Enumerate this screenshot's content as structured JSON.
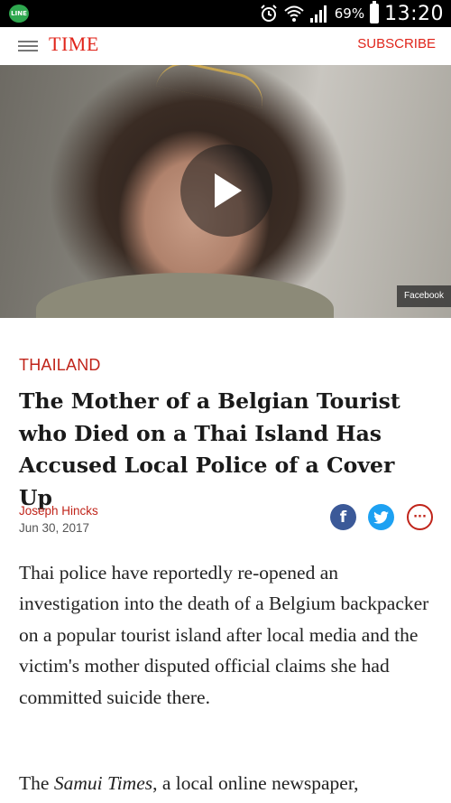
{
  "status_bar": {
    "app_icon_label": "LINE",
    "battery_percent": "69%",
    "time": "13:20",
    "icons": [
      "alarm-icon",
      "wifi-icon",
      "signal-icon",
      "battery-icon"
    ]
  },
  "header": {
    "logo": "TIME",
    "subscribe_label": "SUBSCRIBE",
    "brand_color": "#e0251b"
  },
  "video": {
    "source_badge": "Facebook"
  },
  "article": {
    "section": "THAILAND",
    "headline": "The Mother of a Belgian Tourist who Died on a Thai Island Has Accused Local Police of a Cover Up",
    "author": "Joseph Hincks",
    "date": "Jun 30, 2017",
    "share": {
      "facebook_glyph": "f",
      "more_glyph": "···"
    },
    "paragraph1": "Thai police have reportedly re-opened an investigation into the death of a Belgium backpacker on a popular tourist island after local media and the victim's mother disputed official claims she had committed suicide there.",
    "paragraph2_prefix": "The ",
    "paragraph2_italic": "Samui Times",
    "paragraph2_suffix": ", a local online newspaper,"
  }
}
